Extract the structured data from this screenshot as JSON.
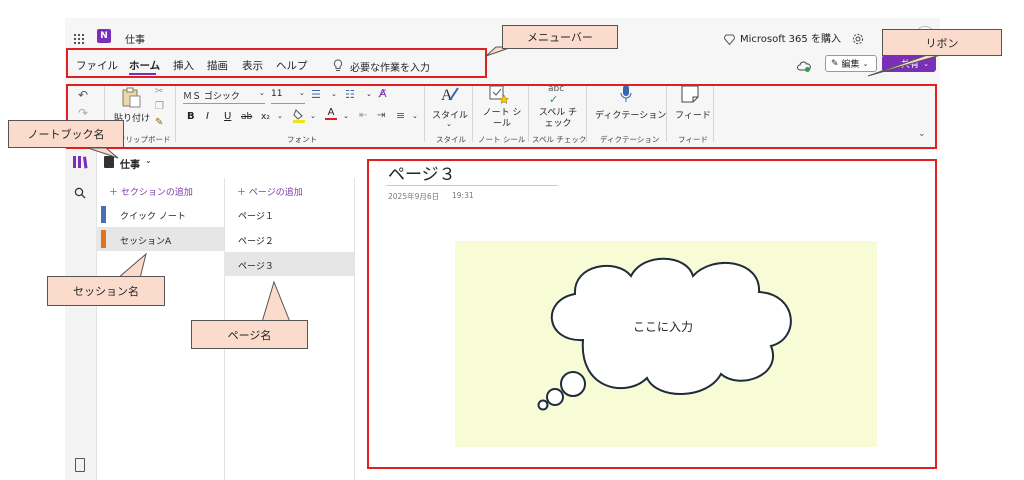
{
  "app": {
    "title": "仕事",
    "buy_label": "Microsoft 365 を購入"
  },
  "menu": {
    "items": [
      "ファイル",
      "ホーム",
      "挿入",
      "描画",
      "表示",
      "ヘルプ"
    ],
    "active": "ホーム",
    "search_placeholder": "必要な作業を入力"
  },
  "actions": {
    "edit_label": "編集",
    "share_label": "共有"
  },
  "ribbon": {
    "clipboard": {
      "paste_label": "貼り付け",
      "group_label": "クリップボード"
    },
    "font": {
      "font_name": "ＭＳ ゴシック",
      "font_size": "11",
      "group_label": "フォント",
      "bold": "B",
      "italic": "I",
      "underline": "U",
      "strike": "ab",
      "subscript": "x₂",
      "font_color": "A"
    },
    "styles": {
      "label": "スタイル",
      "group_label": "スタイル"
    },
    "tags": {
      "label": "ノート シール",
      "group_label": "ノート シール"
    },
    "spelling": {
      "label": "スペル チェック",
      "group_label": "スペル チェック",
      "icon_text": "abc"
    },
    "dictation": {
      "label": "ディクテーション",
      "group_label": "ディクテーション"
    },
    "feed": {
      "label": "フィード",
      "group_label": "フィード"
    }
  },
  "notebook": {
    "name": "仕事"
  },
  "sections": {
    "add_label": "セクションの追加",
    "items": [
      "クイック ノート",
      "セッションA"
    ],
    "selected": "セッションA",
    "colors": [
      "#4a6fb5",
      "#e0741e"
    ]
  },
  "pages": {
    "add_label": "ページの追加",
    "items": [
      "ページ１",
      "ページ２",
      "ページ３"
    ],
    "selected": "ページ３"
  },
  "page": {
    "title": "ページ３",
    "date": "2025年9月6日",
    "time": "19:31",
    "bubble_text": "ここに入力"
  },
  "annotations": {
    "menubar": "メニューバー",
    "ribbon": "リボン",
    "notebook": "ノートブック名",
    "section": "セッション名",
    "page": "ページ名"
  },
  "colors": {
    "accent_purple": "#7b2fb8",
    "annotation_red": "#e02020",
    "callout_fill": "#fbdccc",
    "canvas_yellow": "#f7fbd6"
  }
}
